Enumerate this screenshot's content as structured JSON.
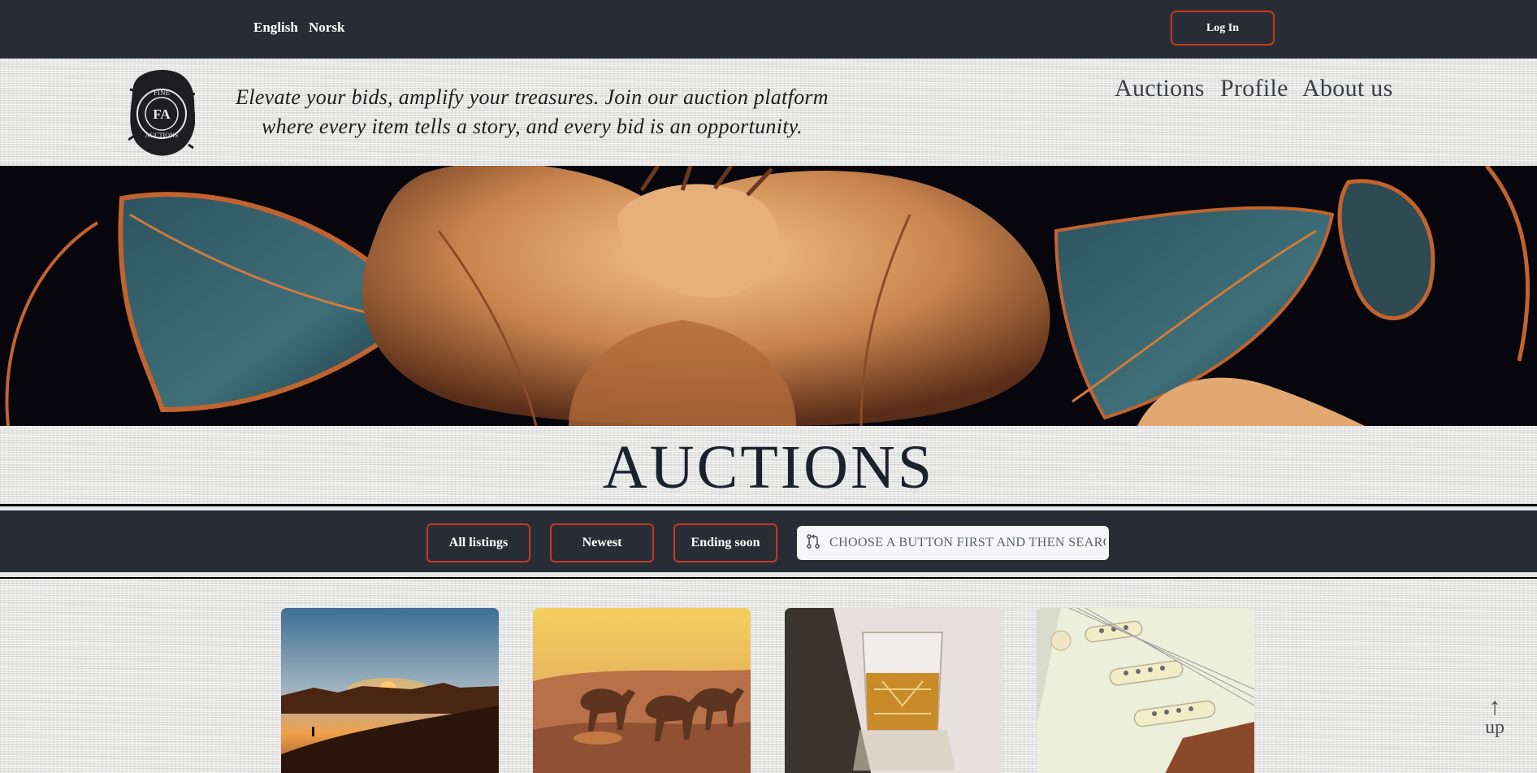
{
  "topbar": {
    "languages": [
      "English",
      "Norsk"
    ],
    "login_label": "Log In",
    "accent": "#c2391f",
    "background": "#282d35"
  },
  "header": {
    "logo_top": "FINE",
    "logo_bottom": "AUCTIONS",
    "logo_monogram": "FA",
    "tagline_line1": "Elevate your bids, amplify your treasures. Join our auction platform",
    "tagline_line2": "where every item tells a story, and every bid is an opportunity.",
    "nav": [
      "Auctions",
      "Profile",
      "About us"
    ]
  },
  "page_title": "AUCTIONS",
  "filters": {
    "buttons": [
      "All listings",
      "Newest",
      "Ending soon"
    ],
    "search_placeholder": "CHOOSE A BUTTON FIRST AND THEN SEARCH",
    "search_icon": "git-pull-request-icon"
  },
  "listings": [
    {
      "image": "desert-sunset-walker"
    },
    {
      "image": "running-camels"
    },
    {
      "image": "whiskey-glass"
    },
    {
      "image": "electric-guitar-pickups"
    }
  ],
  "scroll_up_label": "up"
}
